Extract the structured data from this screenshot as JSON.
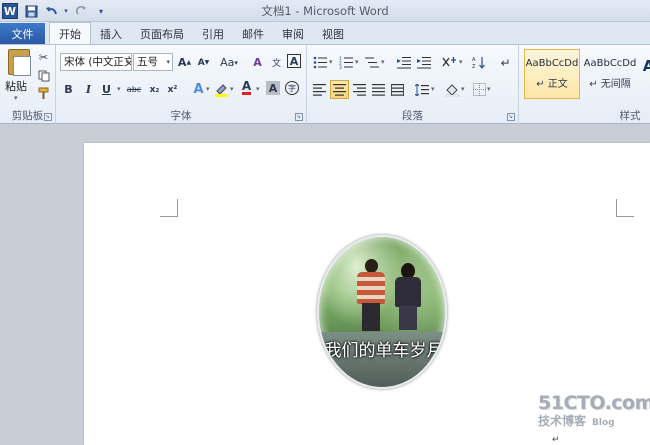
{
  "app": {
    "window_title": "文档1 - Microsoft Word",
    "logo_letter": "W"
  },
  "quick_access": {
    "save_icon": "save-icon",
    "undo_icon": "undo-icon",
    "redo_icon": "redo-icon",
    "customize_icon": "customize-icon"
  },
  "tabs": [
    {
      "label": "文件",
      "type": "file"
    },
    {
      "label": "开始",
      "active": true
    },
    {
      "label": "插入"
    },
    {
      "label": "页面布局"
    },
    {
      "label": "引用"
    },
    {
      "label": "邮件"
    },
    {
      "label": "审阅"
    },
    {
      "label": "视图"
    }
  ],
  "ribbon": {
    "clipboard": {
      "label": "剪贴板",
      "paste_label": "粘贴"
    },
    "font": {
      "label": "字体",
      "font_name": "宋体 (中文正文)",
      "font_size": "五号",
      "bold": "B",
      "italic": "I",
      "underline": "U",
      "strike": "abc",
      "subscript": "x₂",
      "superscript": "x²",
      "grow": "A",
      "shrink": "A",
      "case": "Aa",
      "clear": "A",
      "font_color_letter": "A",
      "char_shade": "A",
      "enclose": "字"
    },
    "paragraph": {
      "label": "段落"
    },
    "styles": {
      "label": "样式",
      "items": [
        {
          "preview": "AaBbCcDd",
          "name": "正文",
          "active": true
        },
        {
          "preview": "AaBbCcDd",
          "name": "无间隔"
        }
      ],
      "more_letter": "A"
    }
  },
  "document": {
    "photo_caption": "我们的单车岁月",
    "para_mark": "↵"
  },
  "watermark": {
    "top": "51CTO.com",
    "bottom": "技术博客",
    "blog": "Blog"
  },
  "colors": {
    "file_tab": "#2b5aa6",
    "accent": "#e6b74b",
    "font_color": "#e02020",
    "highlight": "#ffff00"
  }
}
